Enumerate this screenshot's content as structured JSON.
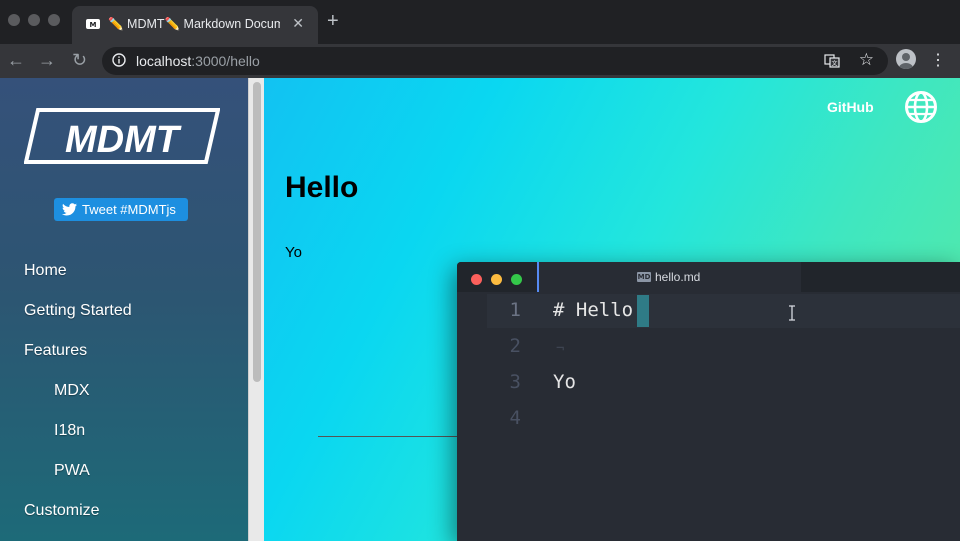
{
  "browser": {
    "tab_title": "✏️ MDMT✏️ Markdown Docume",
    "close_symbol": "✕",
    "newtab_symbol": "+",
    "back_symbol": "←",
    "forward_symbol": "→",
    "reload_symbol": "↻",
    "url_host": "localhost",
    "url_path": ":3000/hello",
    "bookmark_symbol": "☆",
    "menu_symbol": "⋮"
  },
  "sidebar": {
    "logo_text": "MDMT",
    "tweet_label": "Tweet #MDMTjs",
    "nav": [
      {
        "label": "Home"
      },
      {
        "label": "Getting Started"
      },
      {
        "label": "Features"
      },
      {
        "label": "MDX"
      },
      {
        "label": "I18n"
      },
      {
        "label": "PWA"
      },
      {
        "label": "Customize"
      }
    ]
  },
  "header": {
    "github_label": "GitHub"
  },
  "main": {
    "title": "Hello",
    "body": "Yo"
  },
  "editor": {
    "file_name": "hello.md",
    "md_icon_text": "MD",
    "line_numbers": [
      "1",
      "2",
      "3",
      "4"
    ],
    "line1": "# Hello",
    "line2_marker": "¬",
    "line3": "Yo"
  },
  "colors": {
    "accent": "#1d8fe0",
    "editor_bg": "#282c34",
    "heading_syntax": "#d9e68c"
  }
}
